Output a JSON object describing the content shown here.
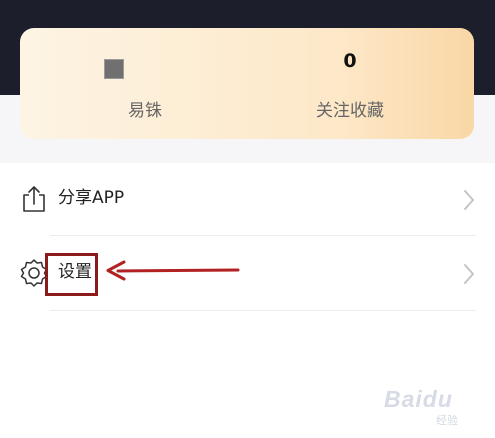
{
  "stats": {
    "left": {
      "label": "易铢"
    },
    "right": {
      "value": "0",
      "label": "关注收藏"
    }
  },
  "menu": {
    "share": {
      "label": "分享APP",
      "icon": "share-icon"
    },
    "settings": {
      "label": "设置",
      "icon": "gear-icon"
    }
  },
  "annotation": {
    "color": "#8b1a1a"
  },
  "watermark": {
    "text": "Baidu",
    "sub": "经验"
  },
  "colors": {
    "top_band": "#1c1e2b",
    "card_gradient_end": "#f9d7a6"
  }
}
